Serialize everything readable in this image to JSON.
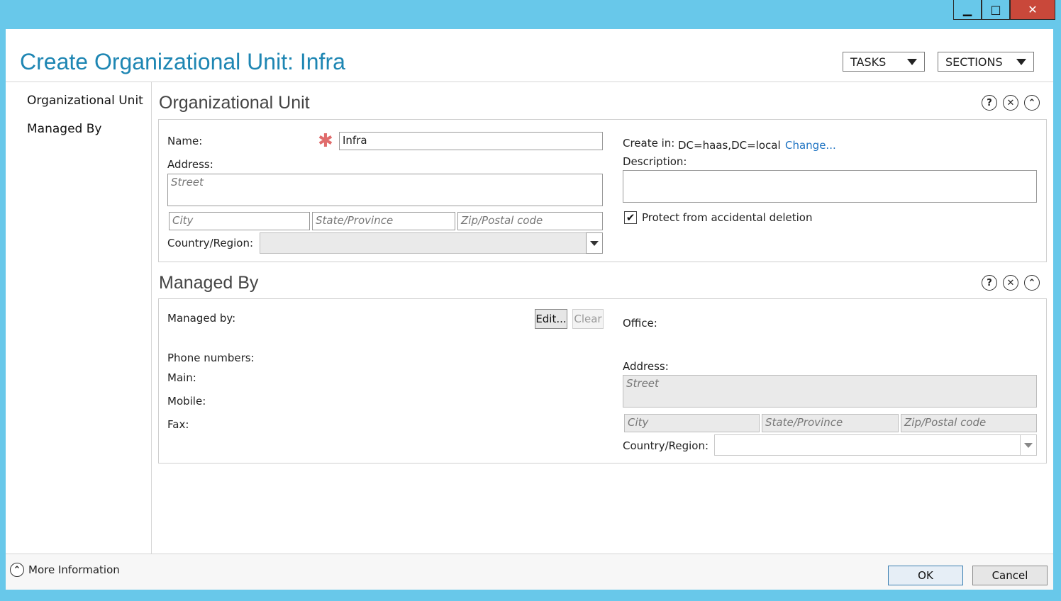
{
  "window": {
    "minimize_glyph": "▁",
    "maximize_glyph": "□",
    "close_glyph": "✕"
  },
  "header": {
    "title": "Create Organizational Unit: Infra",
    "tasks_label": "TASKS",
    "sections_label": "SECTIONS"
  },
  "nav": {
    "items": [
      {
        "label": "Organizational Unit"
      },
      {
        "label": "Managed By"
      }
    ]
  },
  "ou_section": {
    "title": "Organizational Unit",
    "name_label": "Name:",
    "name_value": "Infra",
    "required_glyph": "✱",
    "address_label": "Address:",
    "street_placeholder": "Street",
    "city_placeholder": "City",
    "state_placeholder": "State/Province",
    "zip_placeholder": "Zip/Postal code",
    "country_label": "Country/Region:",
    "country_value": "",
    "create_in_label": "Create in:",
    "create_in_value": "DC=haas,DC=local",
    "change_link": "Change...",
    "description_label": "Description:",
    "description_value": "",
    "protect_label": "Protect from accidental deletion",
    "protect_checked": true
  },
  "managed_section": {
    "title": "Managed By",
    "managed_by_label": "Managed by:",
    "edit_button": "Edit...",
    "clear_button": "Clear",
    "phone_numbers_label": "Phone numbers:",
    "main_label": "Main:",
    "mobile_label": "Mobile:",
    "fax_label": "Fax:",
    "office_label": "Office:",
    "address_label": "Address:",
    "street_placeholder": "Street",
    "city_placeholder": "City",
    "state_placeholder": "State/Province",
    "zip_placeholder": "Zip/Postal code",
    "country_label": "Country/Region:",
    "country_value": ""
  },
  "icons": {
    "help": "?",
    "close": "✕",
    "collapse": "⌃"
  },
  "footer": {
    "more_info_label": "More Information",
    "ok_button": "OK",
    "cancel_button": "Cancel"
  },
  "colors": {
    "frame": "#68c8ea",
    "title": "#1e86b3",
    "close_button": "#c9483a",
    "link": "#1e73c2",
    "required": "#e06c6c"
  }
}
